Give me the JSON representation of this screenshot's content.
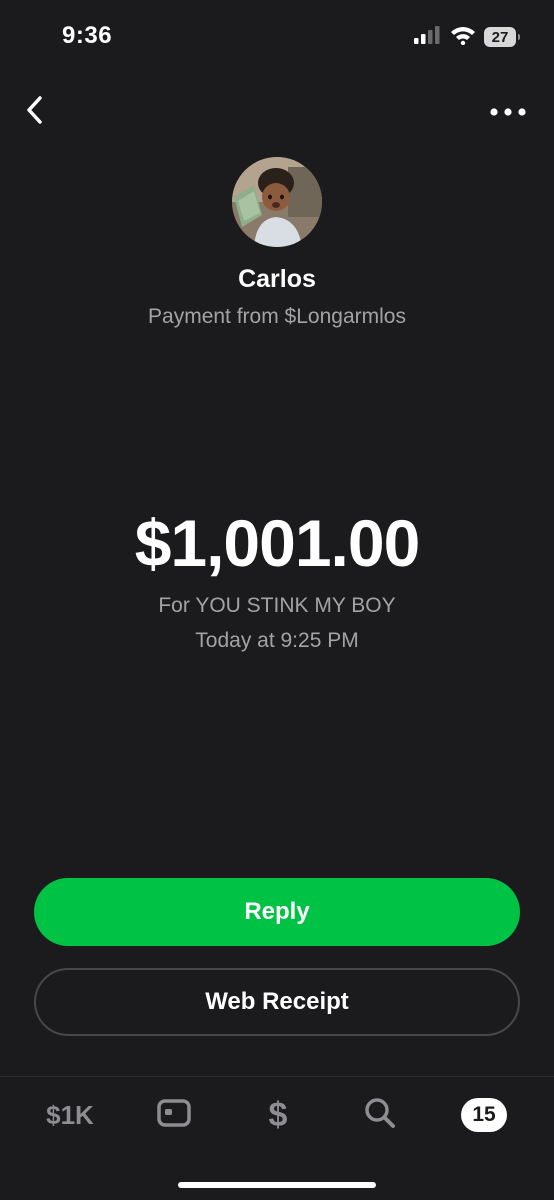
{
  "status_bar": {
    "time": "9:36",
    "battery": "27",
    "icons": [
      "cellular-signal-icon",
      "wifi-icon",
      "battery-icon"
    ]
  },
  "nav": {
    "back_icon": "chevron-left-icon",
    "more_icon": "ellipsis-icon"
  },
  "profile": {
    "name": "Carlos",
    "subtitle": "Payment from $Longarmlos"
  },
  "payment": {
    "amount": "$1,001.00",
    "note": "For YOU STINK MY BOY",
    "timestamp": "Today at 9:25 PM"
  },
  "actions": {
    "reply_label": "Reply",
    "receipt_label": "Web Receipt"
  },
  "tab_bar": {
    "balance_label": "$1K",
    "pay_label": "$",
    "activity_count": "15",
    "icons": [
      "card-icon",
      "search-icon"
    ]
  },
  "colors": {
    "background": "#1b1b1d",
    "accent_green": "#00c244",
    "muted_text": "#a3a3a6",
    "tab_icon": "#8e8e92"
  }
}
